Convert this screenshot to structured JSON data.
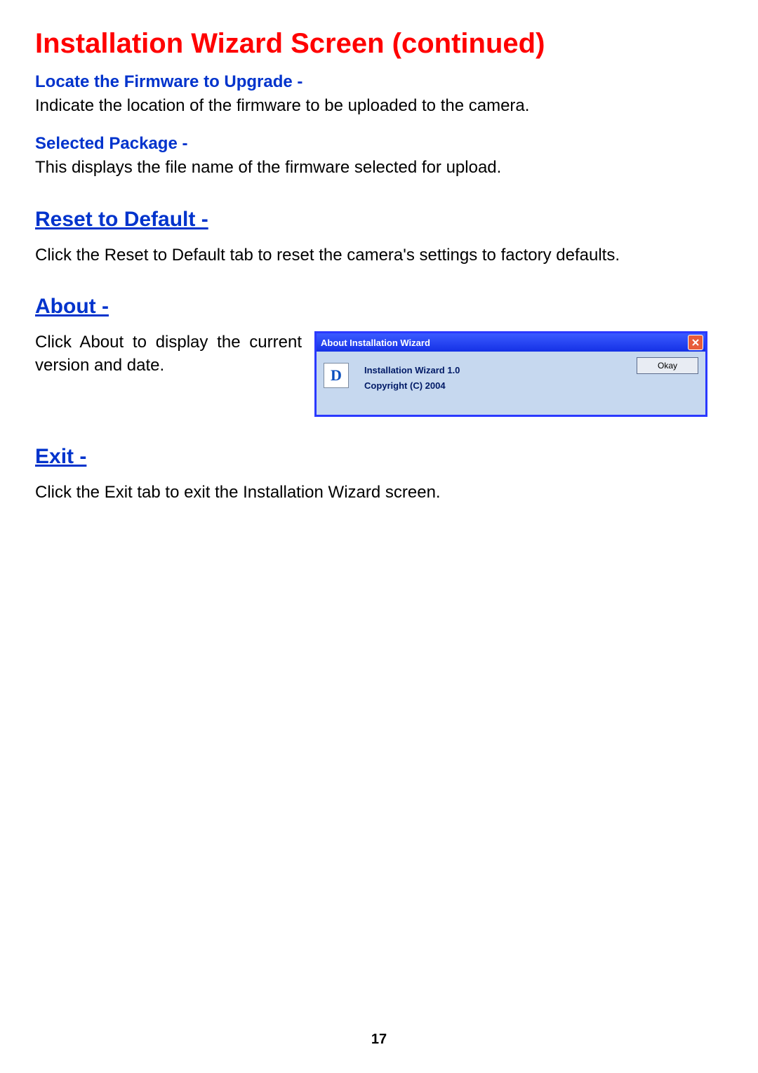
{
  "title": "Installation Wizard Screen (continued)",
  "sections": {
    "locate": {
      "heading": "Locate the Firmware to Upgrade -",
      "body": "Indicate the location of the firmware to be uploaded to the camera."
    },
    "selected": {
      "heading": "Selected Package -",
      "body": "This displays the file name of the firmware selected for upload."
    },
    "reset": {
      "heading": "Reset to Default -",
      "body": "Click the Reset to Default tab to reset the camera's settings to factory defaults."
    },
    "about": {
      "heading": "About -",
      "body": "Click About to display the current version and date."
    },
    "exit": {
      "heading": "Exit -",
      "body": "Click the Exit tab to exit the Installation Wizard screen."
    }
  },
  "dialog": {
    "title": "About Installation Wizard",
    "logo_letter": "D",
    "line1": "Installation Wizard 1.0",
    "line2": "Copyright (C) 2004",
    "ok_label": "Okay"
  },
  "page_number": "17"
}
